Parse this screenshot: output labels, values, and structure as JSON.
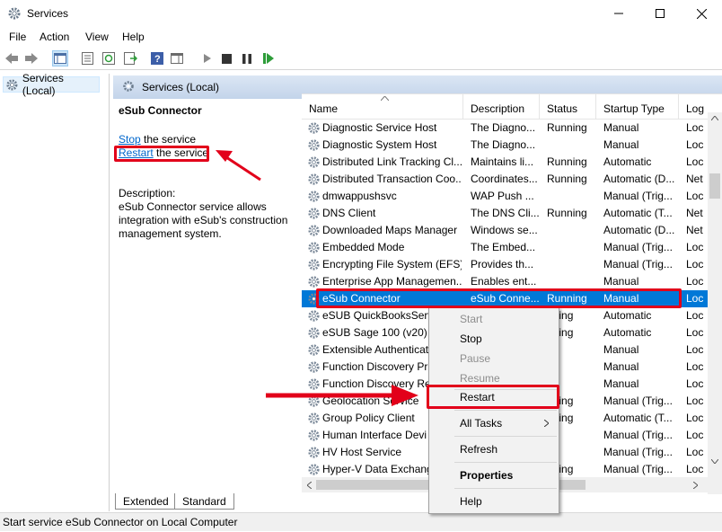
{
  "window": {
    "title": "Services"
  },
  "menubar": [
    "File",
    "Action",
    "View",
    "Help"
  ],
  "tree": {
    "root": "Services (Local)"
  },
  "content": {
    "header": "Services (Local)",
    "selected_title": "eSub Connector",
    "stop_link": "Stop",
    "stop_suffix": " the service",
    "restart_link": "Restart",
    "restart_suffix": " the service",
    "description_label": "Description:",
    "description": "eSub Connector service allows integration with eSub's construction management system."
  },
  "columns": [
    "Name",
    "Description",
    "Status",
    "Startup Type",
    "Log"
  ],
  "rows": [
    {
      "name": "Diagnostic Service Host",
      "desc": "The Diagno...",
      "status": "Running",
      "startup": "Manual",
      "log": "Loc"
    },
    {
      "name": "Diagnostic System Host",
      "desc": "The Diagno...",
      "status": "",
      "startup": "Manual",
      "log": "Loc"
    },
    {
      "name": "Distributed Link Tracking Cl...",
      "desc": "Maintains li...",
      "status": "Running",
      "startup": "Automatic",
      "log": "Loc"
    },
    {
      "name": "Distributed Transaction Coo...",
      "desc": "Coordinates...",
      "status": "Running",
      "startup": "Automatic (D...",
      "log": "Net"
    },
    {
      "name": "dmwappushsvc",
      "desc": "WAP Push ...",
      "status": "",
      "startup": "Manual (Trig...",
      "log": "Loc"
    },
    {
      "name": "DNS Client",
      "desc": "The DNS Cli...",
      "status": "Running",
      "startup": "Automatic (T...",
      "log": "Net"
    },
    {
      "name": "Downloaded Maps Manager",
      "desc": "Windows se...",
      "status": "",
      "startup": "Automatic (D...",
      "log": "Net"
    },
    {
      "name": "Embedded Mode",
      "desc": "The Embed...",
      "status": "",
      "startup": "Manual (Trig...",
      "log": "Loc"
    },
    {
      "name": "Encrypting File System (EFS)",
      "desc": "Provides th...",
      "status": "",
      "startup": "Manual (Trig...",
      "log": "Loc"
    },
    {
      "name": "Enterprise App Managemen...",
      "desc": "Enables ent...",
      "status": "",
      "startup": "Manual",
      "log": "Loc"
    },
    {
      "name": "eSub Connector",
      "desc": "eSub Conne...",
      "status": "Running",
      "startup": "Manual",
      "log": "Loc"
    },
    {
      "name": "eSUB QuickBooksServ",
      "desc": "",
      "status": "nning",
      "startup": "Automatic",
      "log": "Loc"
    },
    {
      "name": "eSUB Sage 100 (v20) C",
      "desc": "",
      "status": "nning",
      "startup": "Automatic",
      "log": "Loc"
    },
    {
      "name": "Extensible Authenticat",
      "desc": "",
      "status": "",
      "startup": "Manual",
      "log": "Loc"
    },
    {
      "name": "Function Discovery Pr",
      "desc": "",
      "status": "",
      "startup": "Manual",
      "log": "Loc"
    },
    {
      "name": "Function Discovery Re",
      "desc": "",
      "status": "",
      "startup": "Manual",
      "log": "Loc"
    },
    {
      "name": "Geolocation Service",
      "desc": "",
      "status": "nning",
      "startup": "Manual (Trig...",
      "log": "Loc"
    },
    {
      "name": "Group Policy Client",
      "desc": "",
      "status": "nning",
      "startup": "Automatic (T...",
      "log": "Loc"
    },
    {
      "name": "Human Interface Devi",
      "desc": "",
      "status": "",
      "startup": "Manual (Trig...",
      "log": "Loc"
    },
    {
      "name": "HV Host Service",
      "desc": "",
      "status": "",
      "startup": "Manual (Trig...",
      "log": "Loc"
    },
    {
      "name": "Hyper-V Data Exchang",
      "desc": "",
      "status": "nning",
      "startup": "Manual (Trig...",
      "log": "Loc"
    }
  ],
  "context_menu": {
    "start": "Start",
    "stop": "Stop",
    "pause": "Pause",
    "resume": "Resume",
    "restart": "Restart",
    "all_tasks": "All Tasks",
    "refresh": "Refresh",
    "properties": "Properties",
    "help": "Help"
  },
  "tabs": [
    "Extended",
    "Standard"
  ],
  "status_text": "Start service eSub Connector on Local Computer",
  "colors": {
    "selection": "#0078d7",
    "highlight_red": "#e2001a",
    "header_blue": "#c3d4ea"
  }
}
